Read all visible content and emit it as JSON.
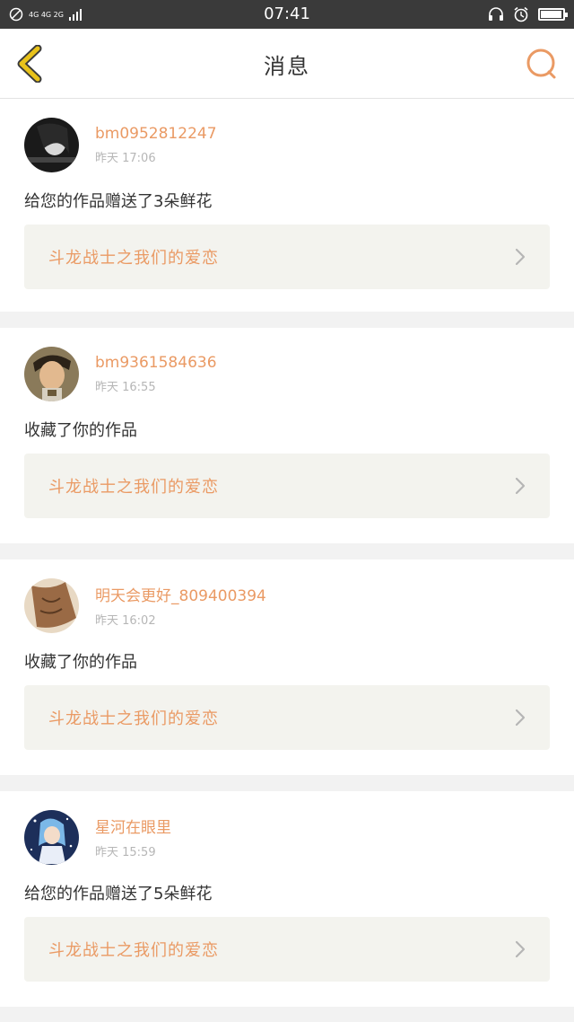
{
  "status_bar": {
    "network": "4G 4G 2G",
    "time": "07:41",
    "battery_level": 0.95
  },
  "header": {
    "title": "消息",
    "back_icon": "chevron-left-icon",
    "search_icon": "search-icon"
  },
  "colors": {
    "accent": "#ea9a64",
    "back_accent": "#e8c21a",
    "card_link_bg": "#f3f3ee",
    "page_bg": "#f2f2f2"
  },
  "messages": [
    {
      "username": "bm0952812247",
      "time": "昨天 17:06",
      "text": "给您的作品赠送了3朵鲜花",
      "work_title": "斗龙战士之我们的爱恋"
    },
    {
      "username": "bm9361584636",
      "time": "昨天 16:55",
      "text": "收藏了你的作品",
      "work_title": "斗龙战士之我们的爱恋"
    },
    {
      "username": "明天会更好_809400394",
      "time": "昨天 16:02",
      "text": "收藏了你的作品",
      "work_title": "斗龙战士之我们的爱恋"
    },
    {
      "username": "星河在眼里",
      "time": "昨天 15:59",
      "text": "给您的作品赠送了5朵鲜花",
      "work_title": "斗龙战士之我们的爱恋"
    }
  ]
}
